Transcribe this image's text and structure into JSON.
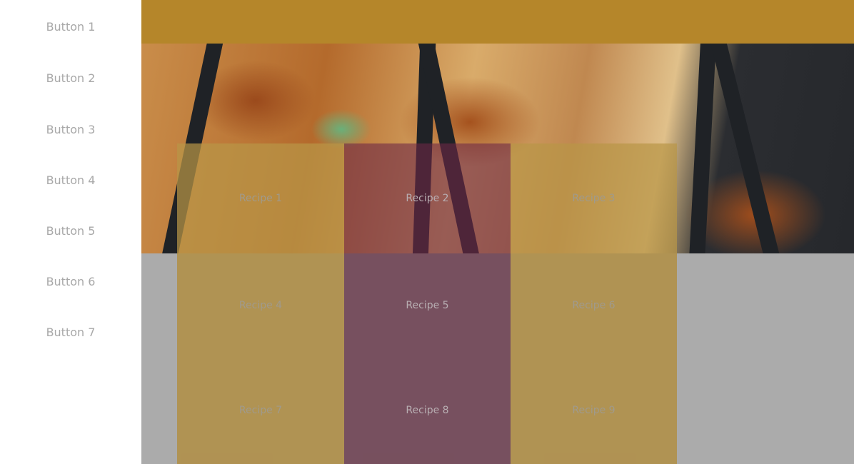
{
  "sidebar": {
    "items": [
      {
        "label": "Button 1"
      },
      {
        "label": "Button 2"
      },
      {
        "label": "Button 3"
      },
      {
        "label": "Button 4"
      },
      {
        "label": "Button 5"
      },
      {
        "label": "Button 6"
      },
      {
        "label": "Button 7"
      }
    ]
  },
  "colors": {
    "header": "#b5862a",
    "tile_gold": "#b18f47",
    "tile_purple": "#714656",
    "background": "#ababab"
  },
  "recipes": [
    {
      "label": "Recipe 1"
    },
    {
      "label": "Recipe 2"
    },
    {
      "label": "Recipe 3"
    },
    {
      "label": "Recipe 4"
    },
    {
      "label": "Recipe 5"
    },
    {
      "label": "Recipe 6"
    },
    {
      "label": "Recipe 7"
    },
    {
      "label": "Recipe 8"
    },
    {
      "label": "Recipe 9"
    }
  ]
}
